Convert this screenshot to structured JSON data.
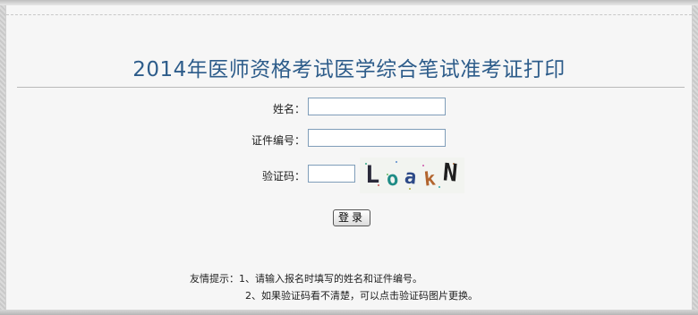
{
  "page": {
    "title": "2014年医师资格考试医学综合笔试准考证打印"
  },
  "form": {
    "name_label": "姓名：",
    "name_value": "",
    "id_label": "证件编号：",
    "id_value": "",
    "captcha_label": "验证码：",
    "captcha_value": "",
    "captcha_image_text": "LoakN",
    "login_label": "登录"
  },
  "tips": {
    "line1": "友情提示：1、请输入报名时填写的姓名和证件编号。",
    "line2": "2、如果验证码看不清楚，可以点击验证码图片更换。"
  }
}
